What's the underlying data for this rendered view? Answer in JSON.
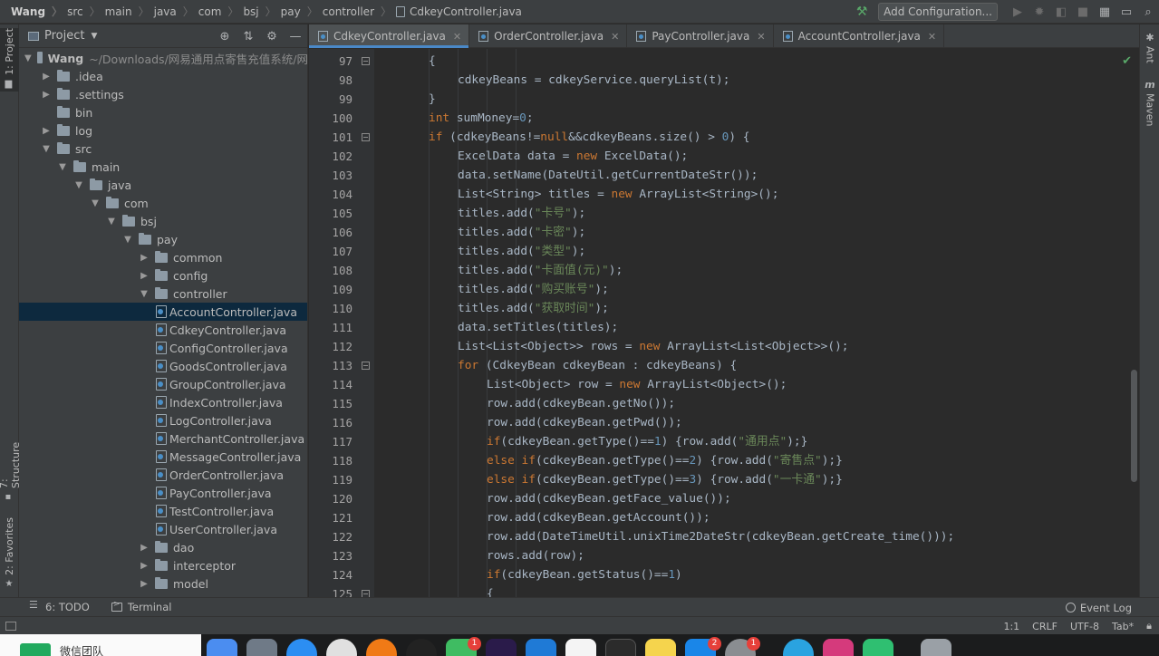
{
  "breadcrumb": [
    "Wang",
    "src",
    "main",
    "java",
    "com",
    "bsj",
    "pay",
    "controller",
    "CdkeyController.java"
  ],
  "toolbar": {
    "add_configuration": "Add Configuration...",
    "icons": [
      "hammer-icon",
      "run-icon",
      "debug-icon",
      "coverage-icon",
      "stop-icon",
      "project-structure-icon",
      "window-layout-icon",
      "search-icon"
    ]
  },
  "left_strip": {
    "project_tab": "1: Project",
    "structure_tab": "7: Structure",
    "favorites_tab": "2: Favorites"
  },
  "right_strip": {
    "ant_tab": "Ant",
    "maven_tab": "Maven"
  },
  "project_panel": {
    "title": "Project",
    "tree": [
      {
        "label": "Wang",
        "hint": "~/Downloads/网易通用点寄售充值系统/网",
        "type": "module",
        "expanded": true
      },
      {
        "label": ".idea",
        "type": "folder",
        "expanded": false
      },
      {
        "label": ".settings",
        "type": "folder",
        "expanded": false
      },
      {
        "label": "bin",
        "type": "folder",
        "leaf": true
      },
      {
        "label": "log",
        "type": "folder",
        "expanded": false
      },
      {
        "label": "src",
        "type": "folder",
        "expanded": true
      },
      {
        "label": "main",
        "type": "folder",
        "expanded": true
      },
      {
        "label": "java",
        "type": "folder",
        "expanded": true
      },
      {
        "label": "com",
        "type": "folder",
        "expanded": true
      },
      {
        "label": "bsj",
        "type": "folder",
        "expanded": true
      },
      {
        "label": "pay",
        "type": "folder",
        "expanded": true
      },
      {
        "label": "common",
        "type": "folder",
        "expanded": false
      },
      {
        "label": "config",
        "type": "folder",
        "expanded": false
      },
      {
        "label": "controller",
        "type": "folder",
        "expanded": true
      },
      {
        "label": "AccountController.java",
        "type": "java",
        "selected": true
      },
      {
        "label": "CdkeyController.java",
        "type": "java"
      },
      {
        "label": "ConfigController.java",
        "type": "java"
      },
      {
        "label": "GoodsController.java",
        "type": "java"
      },
      {
        "label": "GroupController.java",
        "type": "java"
      },
      {
        "label": "IndexController.java",
        "type": "java"
      },
      {
        "label": "LogController.java",
        "type": "java"
      },
      {
        "label": "MerchantController.java",
        "type": "java"
      },
      {
        "label": "MessageController.java",
        "type": "java"
      },
      {
        "label": "OrderController.java",
        "type": "java"
      },
      {
        "label": "PayController.java",
        "type": "java"
      },
      {
        "label": "TestController.java",
        "type": "java"
      },
      {
        "label": "UserController.java",
        "type": "java"
      },
      {
        "label": "dao",
        "type": "folder",
        "expanded": false
      },
      {
        "label": "interceptor",
        "type": "folder",
        "expanded": false
      },
      {
        "label": "model",
        "type": "folder",
        "expanded": false
      }
    ]
  },
  "editor_tabs": [
    {
      "label": "CdkeyController.java",
      "active": true
    },
    {
      "label": "OrderController.java"
    },
    {
      "label": "PayController.java"
    },
    {
      "label": "AccountController.java"
    }
  ],
  "code_lines": [
    {
      "n": "97",
      "indent": 3,
      "tokens": [
        [
          "p",
          "{"
        ]
      ]
    },
    {
      "n": "98",
      "indent": 4,
      "tokens": [
        [
          "p",
          "cdkeyBeans = cdkeyService.queryList(t);"
        ]
      ]
    },
    {
      "n": "99",
      "indent": 3,
      "tokens": [
        [
          "p",
          "}"
        ]
      ]
    },
    {
      "n": "100",
      "indent": 3,
      "tokens": [
        [
          "k",
          "int"
        ],
        [
          "p",
          " sumMoney="
        ],
        [
          "n",
          "0"
        ],
        [
          "p",
          ";"
        ]
      ]
    },
    {
      "n": "101",
      "indent": 3,
      "tokens": [
        [
          "k",
          "if"
        ],
        [
          "p",
          " (cdkeyBeans!="
        ],
        [
          "k",
          "null"
        ],
        [
          "p",
          "&&cdkeyBeans.size() > "
        ],
        [
          "n",
          "0"
        ],
        [
          "p",
          ") {"
        ]
      ]
    },
    {
      "n": "102",
      "indent": 4,
      "tokens": [
        [
          "p",
          "ExcelData data = "
        ],
        [
          "k",
          "new"
        ],
        [
          "p",
          " ExcelData();"
        ]
      ]
    },
    {
      "n": "103",
      "indent": 4,
      "tokens": [
        [
          "p",
          "data.setName(DateUtil.getCurrentDateStr());"
        ]
      ]
    },
    {
      "n": "104",
      "indent": 4,
      "tokens": [
        [
          "p",
          "List<String> titles = "
        ],
        [
          "k",
          "new"
        ],
        [
          "p",
          " ArrayList<String>();"
        ]
      ]
    },
    {
      "n": "105",
      "indent": 4,
      "tokens": [
        [
          "p",
          "titles.add("
        ],
        [
          "s",
          "\"卡号\""
        ],
        [
          "p",
          ");"
        ]
      ]
    },
    {
      "n": "106",
      "indent": 4,
      "tokens": [
        [
          "p",
          "titles.add("
        ],
        [
          "s",
          "\"卡密\""
        ],
        [
          "p",
          ");"
        ]
      ]
    },
    {
      "n": "107",
      "indent": 4,
      "tokens": [
        [
          "p",
          "titles.add("
        ],
        [
          "s",
          "\"类型\""
        ],
        [
          "p",
          ");"
        ]
      ]
    },
    {
      "n": "108",
      "indent": 4,
      "tokens": [
        [
          "p",
          "titles.add("
        ],
        [
          "s",
          "\"卡面值(元)\""
        ],
        [
          "p",
          ");"
        ]
      ]
    },
    {
      "n": "109",
      "indent": 4,
      "tokens": [
        [
          "p",
          "titles.add("
        ],
        [
          "s",
          "\"购买账号\""
        ],
        [
          "p",
          ");"
        ]
      ]
    },
    {
      "n": "110",
      "indent": 4,
      "tokens": [
        [
          "p",
          "titles.add("
        ],
        [
          "s",
          "\"获取时间\""
        ],
        [
          "p",
          ");"
        ]
      ]
    },
    {
      "n": "111",
      "indent": 4,
      "tokens": [
        [
          "p",
          "data.setTitles(titles);"
        ]
      ]
    },
    {
      "n": "112",
      "indent": 4,
      "tokens": [
        [
          "p",
          "List<List<Object>> rows = "
        ],
        [
          "k",
          "new"
        ],
        [
          "p",
          " ArrayList<List<Object>>();"
        ]
      ]
    },
    {
      "n": "113",
      "indent": 4,
      "tokens": [
        [
          "k",
          "for"
        ],
        [
          "p",
          " (CdkeyBean cdkeyBean : cdkeyBeans) {"
        ]
      ]
    },
    {
      "n": "114",
      "indent": 5,
      "tokens": [
        [
          "p",
          "List<Object> row = "
        ],
        [
          "k",
          "new"
        ],
        [
          "p",
          " ArrayList<Object>();"
        ]
      ]
    },
    {
      "n": "115",
      "indent": 5,
      "tokens": [
        [
          "p",
          "row.add(cdkeyBean.getNo());"
        ]
      ]
    },
    {
      "n": "116",
      "indent": 5,
      "tokens": [
        [
          "p",
          "row.add(cdkeyBean.getPwd());"
        ]
      ]
    },
    {
      "n": "117",
      "indent": 5,
      "tokens": [
        [
          "k",
          "if"
        ],
        [
          "p",
          "(cdkeyBean.getType()=="
        ],
        [
          "n",
          "1"
        ],
        [
          "p",
          ") {row.add("
        ],
        [
          "s",
          "\"通用点\""
        ],
        [
          "p",
          ");}"
        ]
      ]
    },
    {
      "n": "118",
      "indent": 5,
      "tokens": [
        [
          "k",
          "else if"
        ],
        [
          "p",
          "(cdkeyBean.getType()=="
        ],
        [
          "n",
          "2"
        ],
        [
          "p",
          ") {row.add("
        ],
        [
          "s",
          "\"寄售点\""
        ],
        [
          "p",
          ");}"
        ]
      ]
    },
    {
      "n": "119",
      "indent": 5,
      "tokens": [
        [
          "k",
          "else if"
        ],
        [
          "p",
          "(cdkeyBean.getType()=="
        ],
        [
          "n",
          "3"
        ],
        [
          "p",
          ") {row.add("
        ],
        [
          "s",
          "\"一卡通\""
        ],
        [
          "p",
          ");}"
        ]
      ]
    },
    {
      "n": "120",
      "indent": 5,
      "tokens": [
        [
          "p",
          "row.add(cdkeyBean.getFace_value());"
        ]
      ]
    },
    {
      "n": "121",
      "indent": 5,
      "tokens": [
        [
          "p",
          "row.add(cdkeyBean.getAccount());"
        ]
      ]
    },
    {
      "n": "122",
      "indent": 5,
      "tokens": [
        [
          "p",
          "row.add(DateTimeUtil.unixTime2DateStr(cdkeyBean.getCreate_time()));"
        ]
      ]
    },
    {
      "n": "123",
      "indent": 5,
      "tokens": [
        [
          "p",
          "rows.add(row);"
        ]
      ]
    },
    {
      "n": "124",
      "indent": 5,
      "tokens": [
        [
          "k",
          "if"
        ],
        [
          "p",
          "(cdkeyBean.getStatus()=="
        ],
        [
          "n",
          "1"
        ],
        [
          "p",
          ")"
        ]
      ]
    },
    {
      "n": "125",
      "indent": 5,
      "tokens": [
        [
          "p",
          "{"
        ]
      ]
    }
  ],
  "bottom_tools": {
    "todo": "6: TODO",
    "terminal": "Terminal",
    "event_log": "Event Log"
  },
  "status": {
    "position": "1:1",
    "line_sep": "CRLF",
    "encoding": "UTF-8",
    "indent": "Tab*"
  },
  "dock": {
    "wechat_label": "微信团队",
    "badges": {
      "wechat": "1",
      "xcode": "2",
      "system_prefs": "1"
    }
  },
  "colors": {
    "background": "#2b2b2b",
    "panel": "#3c3f41",
    "keyword": "#cc7832",
    "number": "#6897bb",
    "string": "#6a8759",
    "selection": "#0d293e",
    "tab_underline": "#4a88c7"
  }
}
